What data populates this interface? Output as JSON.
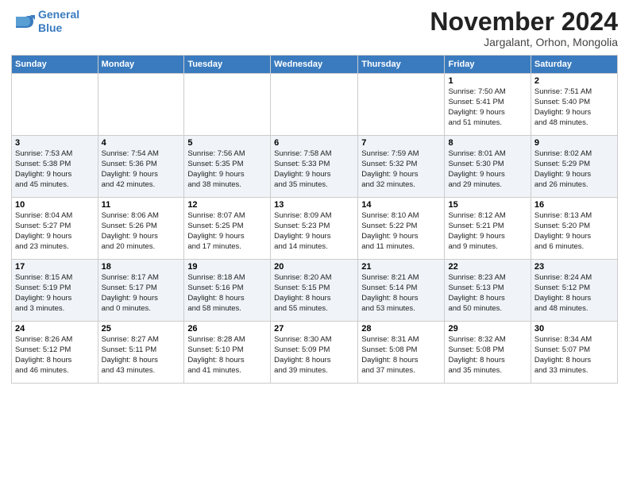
{
  "header": {
    "logo_line1": "General",
    "logo_line2": "Blue",
    "month": "November 2024",
    "location": "Jargalant, Orhon, Mongolia"
  },
  "weekdays": [
    "Sunday",
    "Monday",
    "Tuesday",
    "Wednesday",
    "Thursday",
    "Friday",
    "Saturday"
  ],
  "weeks": [
    [
      {
        "day": "",
        "info": ""
      },
      {
        "day": "",
        "info": ""
      },
      {
        "day": "",
        "info": ""
      },
      {
        "day": "",
        "info": ""
      },
      {
        "day": "",
        "info": ""
      },
      {
        "day": "1",
        "info": "Sunrise: 7:50 AM\nSunset: 5:41 PM\nDaylight: 9 hours\nand 51 minutes."
      },
      {
        "day": "2",
        "info": "Sunrise: 7:51 AM\nSunset: 5:40 PM\nDaylight: 9 hours\nand 48 minutes."
      }
    ],
    [
      {
        "day": "3",
        "info": "Sunrise: 7:53 AM\nSunset: 5:38 PM\nDaylight: 9 hours\nand 45 minutes."
      },
      {
        "day": "4",
        "info": "Sunrise: 7:54 AM\nSunset: 5:36 PM\nDaylight: 9 hours\nand 42 minutes."
      },
      {
        "day": "5",
        "info": "Sunrise: 7:56 AM\nSunset: 5:35 PM\nDaylight: 9 hours\nand 38 minutes."
      },
      {
        "day": "6",
        "info": "Sunrise: 7:58 AM\nSunset: 5:33 PM\nDaylight: 9 hours\nand 35 minutes."
      },
      {
        "day": "7",
        "info": "Sunrise: 7:59 AM\nSunset: 5:32 PM\nDaylight: 9 hours\nand 32 minutes."
      },
      {
        "day": "8",
        "info": "Sunrise: 8:01 AM\nSunset: 5:30 PM\nDaylight: 9 hours\nand 29 minutes."
      },
      {
        "day": "9",
        "info": "Sunrise: 8:02 AM\nSunset: 5:29 PM\nDaylight: 9 hours\nand 26 minutes."
      }
    ],
    [
      {
        "day": "10",
        "info": "Sunrise: 8:04 AM\nSunset: 5:27 PM\nDaylight: 9 hours\nand 23 minutes."
      },
      {
        "day": "11",
        "info": "Sunrise: 8:06 AM\nSunset: 5:26 PM\nDaylight: 9 hours\nand 20 minutes."
      },
      {
        "day": "12",
        "info": "Sunrise: 8:07 AM\nSunset: 5:25 PM\nDaylight: 9 hours\nand 17 minutes."
      },
      {
        "day": "13",
        "info": "Sunrise: 8:09 AM\nSunset: 5:23 PM\nDaylight: 9 hours\nand 14 minutes."
      },
      {
        "day": "14",
        "info": "Sunrise: 8:10 AM\nSunset: 5:22 PM\nDaylight: 9 hours\nand 11 minutes."
      },
      {
        "day": "15",
        "info": "Sunrise: 8:12 AM\nSunset: 5:21 PM\nDaylight: 9 hours\nand 9 minutes."
      },
      {
        "day": "16",
        "info": "Sunrise: 8:13 AM\nSunset: 5:20 PM\nDaylight: 9 hours\nand 6 minutes."
      }
    ],
    [
      {
        "day": "17",
        "info": "Sunrise: 8:15 AM\nSunset: 5:19 PM\nDaylight: 9 hours\nand 3 minutes."
      },
      {
        "day": "18",
        "info": "Sunrise: 8:17 AM\nSunset: 5:17 PM\nDaylight: 9 hours\nand 0 minutes."
      },
      {
        "day": "19",
        "info": "Sunrise: 8:18 AM\nSunset: 5:16 PM\nDaylight: 8 hours\nand 58 minutes."
      },
      {
        "day": "20",
        "info": "Sunrise: 8:20 AM\nSunset: 5:15 PM\nDaylight: 8 hours\nand 55 minutes."
      },
      {
        "day": "21",
        "info": "Sunrise: 8:21 AM\nSunset: 5:14 PM\nDaylight: 8 hours\nand 53 minutes."
      },
      {
        "day": "22",
        "info": "Sunrise: 8:23 AM\nSunset: 5:13 PM\nDaylight: 8 hours\nand 50 minutes."
      },
      {
        "day": "23",
        "info": "Sunrise: 8:24 AM\nSunset: 5:12 PM\nDaylight: 8 hours\nand 48 minutes."
      }
    ],
    [
      {
        "day": "24",
        "info": "Sunrise: 8:26 AM\nSunset: 5:12 PM\nDaylight: 8 hours\nand 46 minutes."
      },
      {
        "day": "25",
        "info": "Sunrise: 8:27 AM\nSunset: 5:11 PM\nDaylight: 8 hours\nand 43 minutes."
      },
      {
        "day": "26",
        "info": "Sunrise: 8:28 AM\nSunset: 5:10 PM\nDaylight: 8 hours\nand 41 minutes."
      },
      {
        "day": "27",
        "info": "Sunrise: 8:30 AM\nSunset: 5:09 PM\nDaylight: 8 hours\nand 39 minutes."
      },
      {
        "day": "28",
        "info": "Sunrise: 8:31 AM\nSunset: 5:08 PM\nDaylight: 8 hours\nand 37 minutes."
      },
      {
        "day": "29",
        "info": "Sunrise: 8:32 AM\nSunset: 5:08 PM\nDaylight: 8 hours\nand 35 minutes."
      },
      {
        "day": "30",
        "info": "Sunrise: 8:34 AM\nSunset: 5:07 PM\nDaylight: 8 hours\nand 33 minutes."
      }
    ]
  ]
}
